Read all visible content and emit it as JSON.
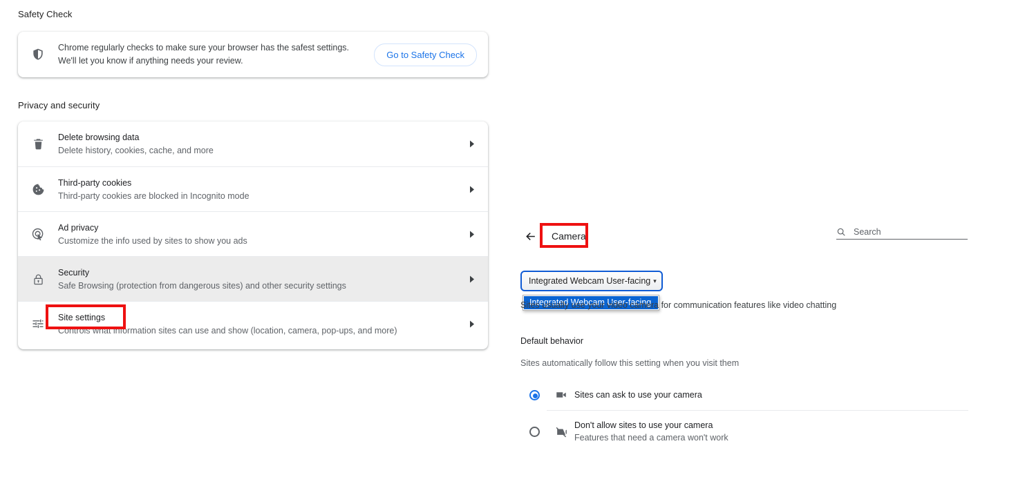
{
  "left": {
    "safety": {
      "section_title": "Safety Check",
      "icon": "shield-icon",
      "text_line1": "Chrome regularly checks to make sure your browser has the safest settings.",
      "text_line2": "We'll let you know if anything needs your review.",
      "button_label": "Go to Safety Check"
    },
    "privacy": {
      "section_title": "Privacy and security",
      "rows": [
        {
          "icon": "trash-icon",
          "title": "Delete browsing data",
          "subtitle": "Delete history, cookies, cache, and more",
          "selected": false
        },
        {
          "icon": "cookie-icon",
          "title": "Third-party cookies",
          "subtitle": "Third-party cookies are blocked in Incognito mode",
          "selected": false
        },
        {
          "icon": "ad-privacy-icon",
          "title": "Ad privacy",
          "subtitle": "Customize the info used by sites to show you ads",
          "selected": false
        },
        {
          "icon": "lock-icon",
          "title": "Security",
          "subtitle": "Safe Browsing (protection from dangerous sites) and other security settings",
          "selected": true
        },
        {
          "icon": "sliders-icon",
          "title": "Site settings",
          "subtitle": "Controls what information sites can use and show (location, camera, pop-ups, and more)",
          "selected": false
        }
      ]
    }
  },
  "right": {
    "back_icon": "back-arrow-icon",
    "title": "Camera",
    "search": {
      "icon": "search-icon",
      "placeholder": "Search",
      "value": ""
    },
    "device_select": {
      "selected_value": "Integrated Webcam User-facing",
      "caret": "▾",
      "expanded": true,
      "options": [
        "Integrated Webcam User-facing"
      ]
    },
    "description": "Sites usually use your video camera for communication features like video chatting",
    "default_behavior": {
      "title": "Default behavior",
      "subtitle": "Sites automatically follow this setting when you visit them",
      "options": [
        {
          "icon": "camera-icon",
          "title": "Sites can ask to use your camera",
          "subtitle": "",
          "checked": true
        },
        {
          "icon": "camera-off-icon",
          "title": "Don't allow sites to use your camera",
          "subtitle": "Features that need a camera won't work",
          "checked": false
        }
      ]
    }
  },
  "highlights": {
    "color": "#ee1111",
    "boxes": [
      "site-settings",
      "camera-title"
    ]
  }
}
